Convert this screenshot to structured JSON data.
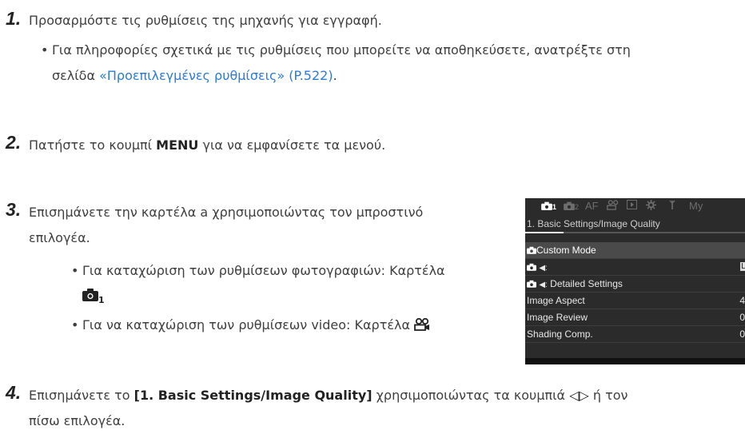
{
  "steps": [
    {
      "num": "1.",
      "text": "Προσαρμόστε τις ρυθμίσεις της μηχανής για εγγραφή."
    },
    {
      "num": "2.",
      "text_before": "Πατήστε το κουμπί ",
      "menu": "MENU",
      "text_after": " για να εμφανίσετε τα μενού."
    },
    {
      "num": "3.",
      "line1": "Επισημάνετε την καρτέλα a χρησιμοποιώντας τον μπροστινό",
      "line2": "επιλογέα."
    },
    {
      "num": "4.",
      "text_before": "Επισημάνετε το ",
      "bold": "[1. Basic Settings/Image Quality]",
      "text_after": " χρησιμοποιώντας τα κουμπιά ",
      "arrows": "◁▷",
      "text_end": " ή τον",
      "line2": "πίσω επιλογέα."
    }
  ],
  "step1_bullet": {
    "line1": "Για πληροφορίες σχετικά με τις ρυθμίσεις που μπορείτε να αποθηκεύσετε, ανατρέξτε στη",
    "line2_prefix": "σελίδα ",
    "link": "«Προεπιλεγμένες ρυθμίσεις» (P.522)",
    "line2_suffix": "."
  },
  "step3_bullets": {
    "photo_line1": "Για καταχώριση των ρυθμίσεων φωτογραφιών: Καρτέλα",
    "photo_tab_sub": "1",
    "video_line": "Για να καταχώριση των ρυθμίσεων video: Καρτέλα "
  },
  "camera_screen": {
    "tabs": [
      "1",
      "2",
      "AF",
      "",
      "",
      "",
      "",
      "My"
    ],
    "subtitle": "1. Basic Settings/Image Quality",
    "rows": [
      {
        "label": "Custom Mode",
        "value": ""
      },
      {
        "label": "",
        "value": "L"
      },
      {
        "label": " Detailed Settings",
        "value": ""
      },
      {
        "label": "Image Aspect",
        "value": "4"
      },
      {
        "label": "Image Review",
        "value": "0"
      },
      {
        "label": "Shading Comp.",
        "value": "0"
      }
    ]
  }
}
